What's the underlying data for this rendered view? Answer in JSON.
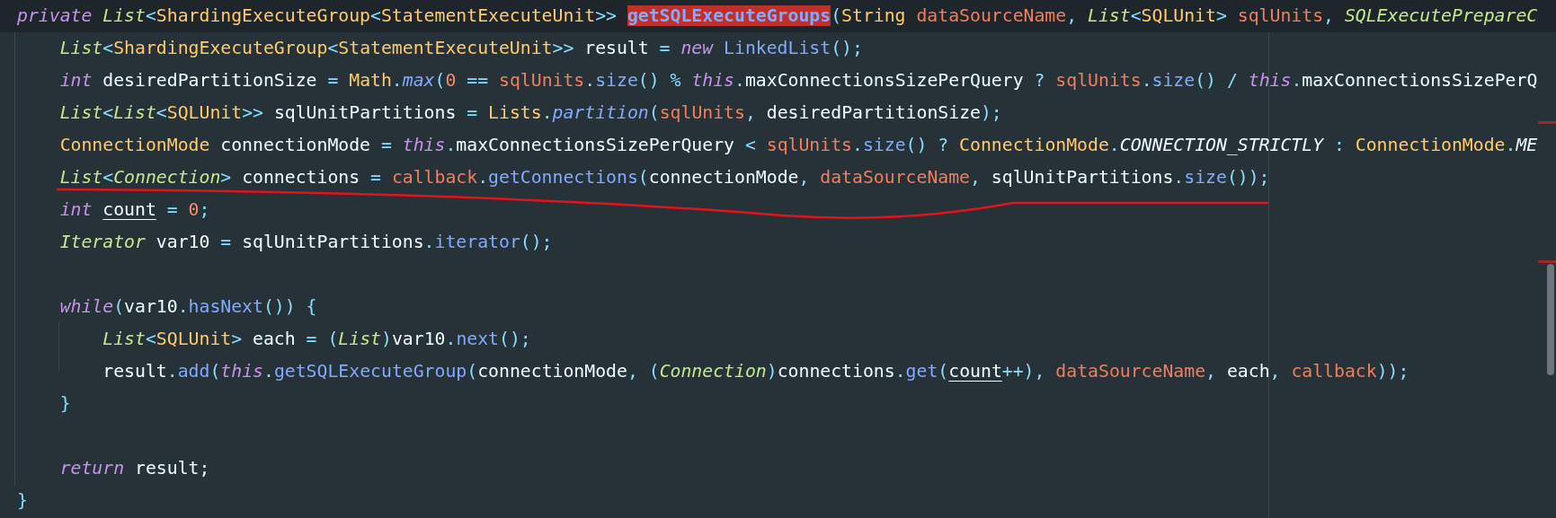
{
  "editor": {
    "lines": [
      {
        "current": true,
        "tokens": [
          {
            "text": "private ",
            "kind": "keyword"
          },
          {
            "text": "List",
            "kind": "type"
          },
          {
            "text": "<",
            "kind": "punct"
          },
          {
            "text": "ShardingExecuteGroup",
            "kind": "class"
          },
          {
            "text": "<",
            "kind": "punct"
          },
          {
            "text": "StatementExecuteUnit",
            "kind": "class"
          },
          {
            "text": ">> ",
            "kind": "punct"
          },
          {
            "text": "getSQLExecuteGroups",
            "kind": "highlight"
          },
          {
            "text": "(",
            "kind": "punct"
          },
          {
            "text": "String ",
            "kind": "class"
          },
          {
            "text": "dataSourceName",
            "kind": "param"
          },
          {
            "text": ", ",
            "kind": "punct"
          },
          {
            "text": "List",
            "kind": "type"
          },
          {
            "text": "<",
            "kind": "punct"
          },
          {
            "text": "SQLUnit",
            "kind": "class"
          },
          {
            "text": "> ",
            "kind": "punct"
          },
          {
            "text": "sqlUnits",
            "kind": "param"
          },
          {
            "text": ", ",
            "kind": "punct"
          },
          {
            "text": "SQLExecutePrepareC",
            "kind": "type"
          }
        ]
      },
      {
        "current": false,
        "tokens": [
          {
            "text": "    List",
            "kind": "type"
          },
          {
            "text": "<",
            "kind": "punct"
          },
          {
            "text": "ShardingExecuteGroup",
            "kind": "class"
          },
          {
            "text": "<",
            "kind": "punct"
          },
          {
            "text": "StatementExecuteUnit",
            "kind": "class"
          },
          {
            "text": ">>",
            "kind": "punct"
          },
          {
            "text": " result ",
            "kind": "plain"
          },
          {
            "text": "= ",
            "kind": "punct"
          },
          {
            "text": "new ",
            "kind": "keyword"
          },
          {
            "text": "LinkedList",
            "kind": "method"
          },
          {
            "text": "();",
            "kind": "punct"
          }
        ]
      },
      {
        "current": false,
        "tokens": [
          {
            "text": "    int",
            "kind": "keyword"
          },
          {
            "text": " desiredPartitionSize ",
            "kind": "plain"
          },
          {
            "text": "= ",
            "kind": "punct"
          },
          {
            "text": "Math",
            "kind": "class"
          },
          {
            "text": ".",
            "kind": "punct"
          },
          {
            "text": "max",
            "kind": "static_method"
          },
          {
            "text": "(",
            "kind": "punct"
          },
          {
            "text": "0",
            "kind": "number"
          },
          {
            "text": " == ",
            "kind": "punct"
          },
          {
            "text": "sqlUnits",
            "kind": "param"
          },
          {
            "text": ".",
            "kind": "punct"
          },
          {
            "text": "size",
            "kind": "method"
          },
          {
            "text": "() % ",
            "kind": "punct"
          },
          {
            "text": "this",
            "kind": "keyword"
          },
          {
            "text": ".",
            "kind": "punct"
          },
          {
            "text": "maxConnectionsSizePerQuery ",
            "kind": "plain"
          },
          {
            "text": "? ",
            "kind": "punct"
          },
          {
            "text": "sqlUnits",
            "kind": "param"
          },
          {
            "text": ".",
            "kind": "punct"
          },
          {
            "text": "size",
            "kind": "method"
          },
          {
            "text": "() / ",
            "kind": "punct"
          },
          {
            "text": "this",
            "kind": "keyword"
          },
          {
            "text": ".",
            "kind": "punct"
          },
          {
            "text": "maxConnectionsSizePerQ",
            "kind": "plain"
          }
        ]
      },
      {
        "current": false,
        "tokens": [
          {
            "text": "    List",
            "kind": "type"
          },
          {
            "text": "<",
            "kind": "punct"
          },
          {
            "text": "List",
            "kind": "type"
          },
          {
            "text": "<",
            "kind": "punct"
          },
          {
            "text": "SQLUnit",
            "kind": "class"
          },
          {
            "text": ">>",
            "kind": "punct"
          },
          {
            "text": " sqlUnitPartitions ",
            "kind": "plain"
          },
          {
            "text": "= ",
            "kind": "punct"
          },
          {
            "text": "Lists",
            "kind": "class"
          },
          {
            "text": ".",
            "kind": "punct"
          },
          {
            "text": "partition",
            "kind": "static_method"
          },
          {
            "text": "(",
            "kind": "punct"
          },
          {
            "text": "sqlUnits",
            "kind": "param"
          },
          {
            "text": ", ",
            "kind": "punct"
          },
          {
            "text": "desiredPartitionSize",
            "kind": "plain"
          },
          {
            "text": ");",
            "kind": "punct"
          }
        ]
      },
      {
        "current": false,
        "tokens": [
          {
            "text": "    ConnectionMode",
            "kind": "class"
          },
          {
            "text": " connectionMode ",
            "kind": "plain"
          },
          {
            "text": "= ",
            "kind": "punct"
          },
          {
            "text": "this",
            "kind": "keyword"
          },
          {
            "text": ".",
            "kind": "punct"
          },
          {
            "text": "maxConnectionsSizePerQuery ",
            "kind": "plain"
          },
          {
            "text": "< ",
            "kind": "punct"
          },
          {
            "text": "sqlUnits",
            "kind": "param"
          },
          {
            "text": ".",
            "kind": "punct"
          },
          {
            "text": "size",
            "kind": "method"
          },
          {
            "text": "() ? ",
            "kind": "punct"
          },
          {
            "text": "ConnectionMode",
            "kind": "class"
          },
          {
            "text": ".",
            "kind": "punct"
          },
          {
            "text": "CONNECTION_STRICTLY",
            "kind": "constant"
          },
          {
            "text": " : ",
            "kind": "punct"
          },
          {
            "text": "ConnectionMode",
            "kind": "class"
          },
          {
            "text": ".",
            "kind": "punct"
          },
          {
            "text": "ME",
            "kind": "constant"
          }
        ]
      },
      {
        "current": false,
        "tokens": [
          {
            "text": "    List",
            "kind": "type"
          },
          {
            "text": "<",
            "kind": "punct"
          },
          {
            "text": "Connection",
            "kind": "type"
          },
          {
            "text": ">",
            "kind": "punct"
          },
          {
            "text": " connections ",
            "kind": "plain"
          },
          {
            "text": "= ",
            "kind": "punct"
          },
          {
            "text": "callback",
            "kind": "param"
          },
          {
            "text": ".",
            "kind": "punct"
          },
          {
            "text": "getConnections",
            "kind": "method"
          },
          {
            "text": "(",
            "kind": "punct"
          },
          {
            "text": "connectionMode",
            "kind": "plain"
          },
          {
            "text": ", ",
            "kind": "punct"
          },
          {
            "text": "dataSourceName",
            "kind": "param"
          },
          {
            "text": ", ",
            "kind": "punct"
          },
          {
            "text": "sqlUnitPartitions",
            "kind": "plain"
          },
          {
            "text": ".",
            "kind": "punct"
          },
          {
            "text": "size",
            "kind": "method"
          },
          {
            "text": "());",
            "kind": "punct"
          }
        ]
      },
      {
        "current": false,
        "tokens": [
          {
            "text": "    int ",
            "kind": "keyword"
          },
          {
            "text": "count",
            "kind": "mutated"
          },
          {
            "text": " = ",
            "kind": "punct"
          },
          {
            "text": "0",
            "kind": "number"
          },
          {
            "text": ";",
            "kind": "punct"
          }
        ]
      },
      {
        "current": false,
        "tokens": [
          {
            "text": "    Iterator",
            "kind": "type"
          },
          {
            "text": " var10 ",
            "kind": "plain"
          },
          {
            "text": "=",
            "kind": "punct"
          },
          {
            "text": " sqlUnitPartitions",
            "kind": "plain"
          },
          {
            "text": ".",
            "kind": "punct"
          },
          {
            "text": "iterator",
            "kind": "method"
          },
          {
            "text": "();",
            "kind": "punct"
          }
        ]
      },
      {
        "current": false
      },
      {
        "current": false,
        "tokens": [
          {
            "text": "    while",
            "kind": "keyword"
          },
          {
            "text": "(",
            "kind": "punct"
          },
          {
            "text": "var10",
            "kind": "plain"
          },
          {
            "text": ".",
            "kind": "punct"
          },
          {
            "text": "hasNext",
            "kind": "method"
          },
          {
            "text": "()) {",
            "kind": "punct"
          }
        ]
      },
      {
        "current": false,
        "tokens": [
          {
            "text": "        List",
            "kind": "type"
          },
          {
            "text": "<",
            "kind": "punct"
          },
          {
            "text": "SQLUnit",
            "kind": "class"
          },
          {
            "text": ">",
            "kind": "punct"
          },
          {
            "text": " each ",
            "kind": "plain"
          },
          {
            "text": "= (",
            "kind": "punct"
          },
          {
            "text": "List",
            "kind": "type"
          },
          {
            "text": ")",
            "kind": "punct"
          },
          {
            "text": "var10",
            "kind": "plain"
          },
          {
            "text": ".",
            "kind": "punct"
          },
          {
            "text": "next",
            "kind": "method"
          },
          {
            "text": "();",
            "kind": "punct"
          }
        ]
      },
      {
        "current": false,
        "tokens": [
          {
            "text": "        result",
            "kind": "plain"
          },
          {
            "text": ".",
            "kind": "punct"
          },
          {
            "text": "add",
            "kind": "method"
          },
          {
            "text": "(",
            "kind": "punct"
          },
          {
            "text": "this",
            "kind": "keyword"
          },
          {
            "text": ".",
            "kind": "punct"
          },
          {
            "text": "getSQLExecuteGroup",
            "kind": "method"
          },
          {
            "text": "(",
            "kind": "punct"
          },
          {
            "text": "connectionMode",
            "kind": "plain"
          },
          {
            "text": ", (",
            "kind": "punct"
          },
          {
            "text": "Connection",
            "kind": "type"
          },
          {
            "text": ")",
            "kind": "punct"
          },
          {
            "text": "connections",
            "kind": "plain"
          },
          {
            "text": ".",
            "kind": "punct"
          },
          {
            "text": "get",
            "kind": "method"
          },
          {
            "text": "(",
            "kind": "punct"
          },
          {
            "text": "count",
            "kind": "mutated"
          },
          {
            "text": "++), ",
            "kind": "punct"
          },
          {
            "text": "dataSourceName",
            "kind": "param"
          },
          {
            "text": ", ",
            "kind": "punct"
          },
          {
            "text": "each",
            "kind": "plain"
          },
          {
            "text": ", ",
            "kind": "punct"
          },
          {
            "text": "callback",
            "kind": "param"
          },
          {
            "text": "));",
            "kind": "punct"
          }
        ]
      },
      {
        "current": false,
        "tokens": [
          {
            "text": "    }",
            "kind": "punct"
          }
        ]
      },
      {
        "current": false
      },
      {
        "current": false,
        "tokens": [
          {
            "text": "    return",
            "kind": "keyword"
          },
          {
            "text": " result;",
            "kind": "plain"
          }
        ]
      },
      {
        "current": false,
        "tokens": [
          {
            "text": "}",
            "kind": "punct"
          }
        ]
      }
    ]
  }
}
